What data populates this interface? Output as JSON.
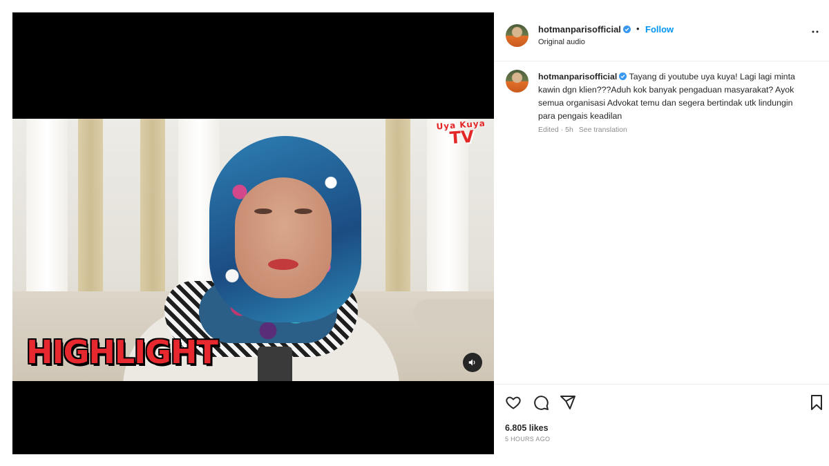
{
  "media": {
    "brand_line1": "Uya Kuya",
    "brand_line2": "TV",
    "overlay_text": "HIGHLIGHT",
    "mute_icon": "speaker-icon"
  },
  "post": {
    "username": "hotmanparisofficial",
    "separator": "•",
    "follow_label": "Follow",
    "audio_label": "Original audio",
    "more_icon": "more-horizontal-icon",
    "caption": {
      "username": "hotmanparisofficial",
      "text": "Tayang di youtube uya kuya! Lagi lagi minta kawin dgn klien???Aduh kok banyak pengaduan masyarakat? Ayok semua organisasi Advokat temu dan segera bertindak utk lindungin para pengais keadilan",
      "meta": "Edited · 5h",
      "see_translation": "See translation"
    },
    "actions": {
      "like_icon": "heart-icon",
      "comment_icon": "comment-icon",
      "share_icon": "send-icon",
      "save_icon": "bookmark-icon"
    },
    "likes": "6.805 likes",
    "timestamp": "5 HOURS AGO"
  },
  "colors": {
    "link": "#0095f6",
    "verified": "#3897f0",
    "highlight_red": "#e8282f",
    "muted_text": "#8e8e8e"
  }
}
